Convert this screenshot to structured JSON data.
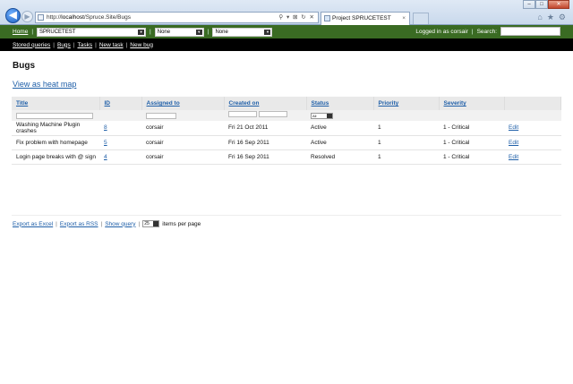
{
  "browser": {
    "url_prefix": "http://",
    "url_host": "localhost",
    "url_path": "/Spruce.Site/Bugs",
    "addr_tools": "⚲ ▾ ⊠ ↻ ✕",
    "tab_title": "Project SPRUCETEST",
    "tab_close": "×",
    "back": "◀",
    "forward": "▶",
    "icons": [
      "home-icon",
      "star-icon",
      "gear-icon"
    ]
  },
  "topbar": {
    "home": "Home",
    "project": "SPRUCETEST",
    "filter1": "None",
    "filter2": "None",
    "logged_in": "Logged in as corsair",
    "search_label": "Search:"
  },
  "subnav": {
    "items": [
      "Stored queries",
      "Bugs",
      "Tasks",
      "New task",
      "New bug"
    ]
  },
  "page": {
    "title": "Bugs",
    "heatmap_link": "View as heat map"
  },
  "grid": {
    "headers": [
      "Title",
      "ID",
      "Assigned to",
      "Created on",
      "Status",
      "Priority",
      "Severity"
    ],
    "status_filter": "All",
    "rows": [
      {
        "title": "Washing Machine Plugin crashes",
        "id": "8",
        "assigned": "corsair",
        "created": "Fri 21 Oct 2011",
        "status": "Active",
        "priority": "1",
        "severity": "1 - Critical",
        "action": "Edit"
      },
      {
        "title": "Fix problem with homepage",
        "id": "5",
        "assigned": "corsair",
        "created": "Fri 16 Sep 2011",
        "status": "Active",
        "priority": "1",
        "severity": "1 - Critical",
        "action": "Edit"
      },
      {
        "title": "Login page breaks with @ sign",
        "id": "4",
        "assigned": "corsair",
        "created": "Fri 16 Sep 2011",
        "status": "Resolved",
        "priority": "1",
        "severity": "1 - Critical",
        "action": "Edit"
      }
    ]
  },
  "footer": {
    "export_excel": "Export as Excel",
    "export_rss": "Export as RSS",
    "show_query": "Show query",
    "page_size": "25",
    "per_page": "items per page"
  },
  "colors": {
    "green_bar": "#3a6b23",
    "link": "#1f5fa8"
  }
}
